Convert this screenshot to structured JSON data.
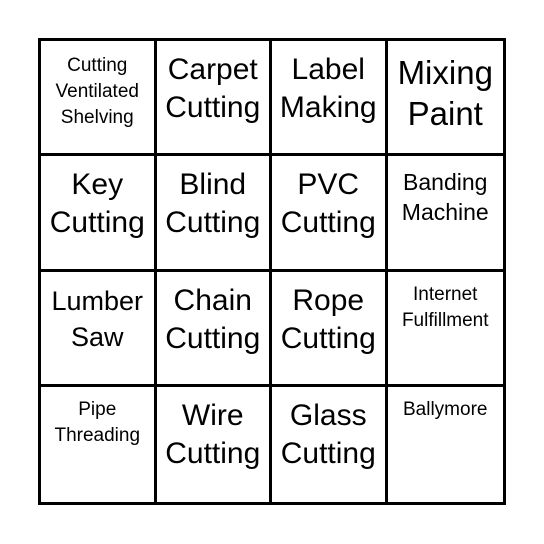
{
  "bingo_card": {
    "cells": [
      {
        "text": "Cutting\nVentilated\nShelving"
      },
      {
        "text": "Carpet\nCutting"
      },
      {
        "text": "Label\nMaking"
      },
      {
        "text": "Mixing\nPaint"
      },
      {
        "text": "Key\nCutting"
      },
      {
        "text": "Blind\nCutting"
      },
      {
        "text": "PVC\nCutting"
      },
      {
        "text": "Banding\nMachine"
      },
      {
        "text": "Lumber\nSaw"
      },
      {
        "text": "Chain\nCutting"
      },
      {
        "text": "Rope\nCutting"
      },
      {
        "text": "Internet\nFulfillment"
      },
      {
        "text": "Pipe\nThreading"
      },
      {
        "text": "Wire\nCutting"
      },
      {
        "text": "Glass\nCutting"
      },
      {
        "text": "Ballymore"
      }
    ]
  }
}
